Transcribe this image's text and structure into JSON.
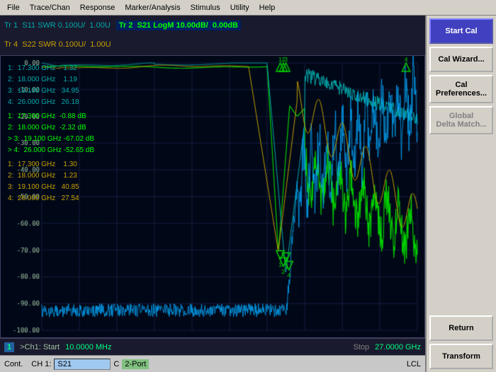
{
  "menubar": {
    "items": [
      "File",
      "Trace/Chan",
      "Response",
      "Marker/Analysis",
      "Stimulus",
      "Utility",
      "Help"
    ]
  },
  "trace_bar": {
    "traces": [
      {
        "id": "Tr 1",
        "name": "S11",
        "type": "SWR",
        "scale": "0.100U/",
        "ref": "1.00U",
        "color": "#00aaaa",
        "active": false
      },
      {
        "id": "Tr 2",
        "name": "S21",
        "type": "LogM",
        "scale": "10.00dB/",
        "ref": "0.00dB",
        "color": "#00ff00",
        "active": true
      },
      {
        "id": "Tr 4",
        "name": "S22",
        "type": "SWR",
        "scale": "0.100U/",
        "ref": "1.00U",
        "color": "#c8a000",
        "active": false
      }
    ]
  },
  "markers": {
    "s11_swr": [
      {
        "num": 1,
        "freq": "17.300 GHz",
        "val": "1.32"
      },
      {
        "num": 2,
        "freq": "18.000 GHz",
        "val": "1.19"
      },
      {
        "num": 3,
        "freq": "19.100 GHz",
        "val": "34.95"
      },
      {
        "num": 4,
        "freq": "26.000 GHz",
        "val": "26.18"
      }
    ],
    "s21_logm": [
      {
        "num": 1,
        "freq": "17.300 GHz",
        "val": "-0.88 dB"
      },
      {
        "num": 2,
        "freq": "18.000 GHz",
        "val": "-2.32 dB"
      },
      {
        "num": 3,
        "freq": "19.100 GHz",
        "val": "-67.02 dB"
      },
      {
        "num": 4,
        "freq": "26.000 GHz",
        "val": "-52.65 dB"
      }
    ],
    "s22_swr": [
      {
        "num": 1,
        "freq": "17.300 GHz",
        "val": "1.30"
      },
      {
        "num": 2,
        "freq": "18.000 GHz",
        "val": "1.23"
      },
      {
        "num": 3,
        "freq": "19.100 GHz",
        "val": "40.85"
      },
      {
        "num": 4,
        "freq": "26.000 GHz",
        "val": "27.54"
      }
    ]
  },
  "y_axis": {
    "labels": [
      "0.00",
      "-10.00",
      "-20.00",
      "-30.00",
      "-40.00",
      "-50.00",
      "-60.00",
      "-70.00",
      "-80.00",
      "-90.00",
      "-100.00"
    ]
  },
  "status_bar": {
    "channel": "1",
    "start": "10.0000 MHz",
    "stop": "27.0000 GHz"
  },
  "bottom_bar": {
    "cont": "Cont.",
    "ch_label": "CH 1:",
    "trace": "S21",
    "c_label": "C",
    "port": "2-Port",
    "lcl": "LCL"
  },
  "right_panel": {
    "buttons": [
      {
        "id": "start-cal",
        "label": "Start Cal",
        "highlight": true
      },
      {
        "id": "cal-wizard",
        "label": "Cal Wizard..."
      },
      {
        "id": "cal-preferences",
        "label": "Cal\nPreferences..."
      },
      {
        "id": "global-delta-match",
        "label": "Global\nDelta Match...",
        "disabled": true
      },
      {
        "id": "return",
        "label": "Return"
      },
      {
        "id": "transform",
        "label": "Transform"
      }
    ]
  }
}
